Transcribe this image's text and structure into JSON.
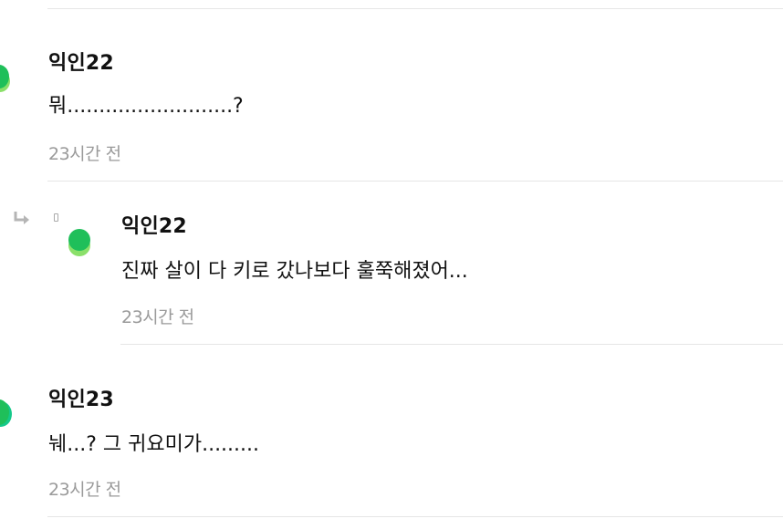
{
  "comments": [
    {
      "author": "익인22",
      "text": "뭐..........................?",
      "time": "23시간 전"
    },
    {
      "author": "익인22",
      "text": "진짜 살이 다 키로 갔나보다 훌쭉해졌어...",
      "time": "23시간 전",
      "is_reply": true
    },
    {
      "author": "익인23",
      "text": "눼...? 그 귀요미가.........",
      "time": "23시간 전"
    }
  ],
  "colors": {
    "avatar_green": "#1fbf5a",
    "avatar_light": "#8be06a",
    "avatar_teal": "#14c98a",
    "time_gray": "#9a9a9a",
    "divider": "#e6e6e6"
  }
}
